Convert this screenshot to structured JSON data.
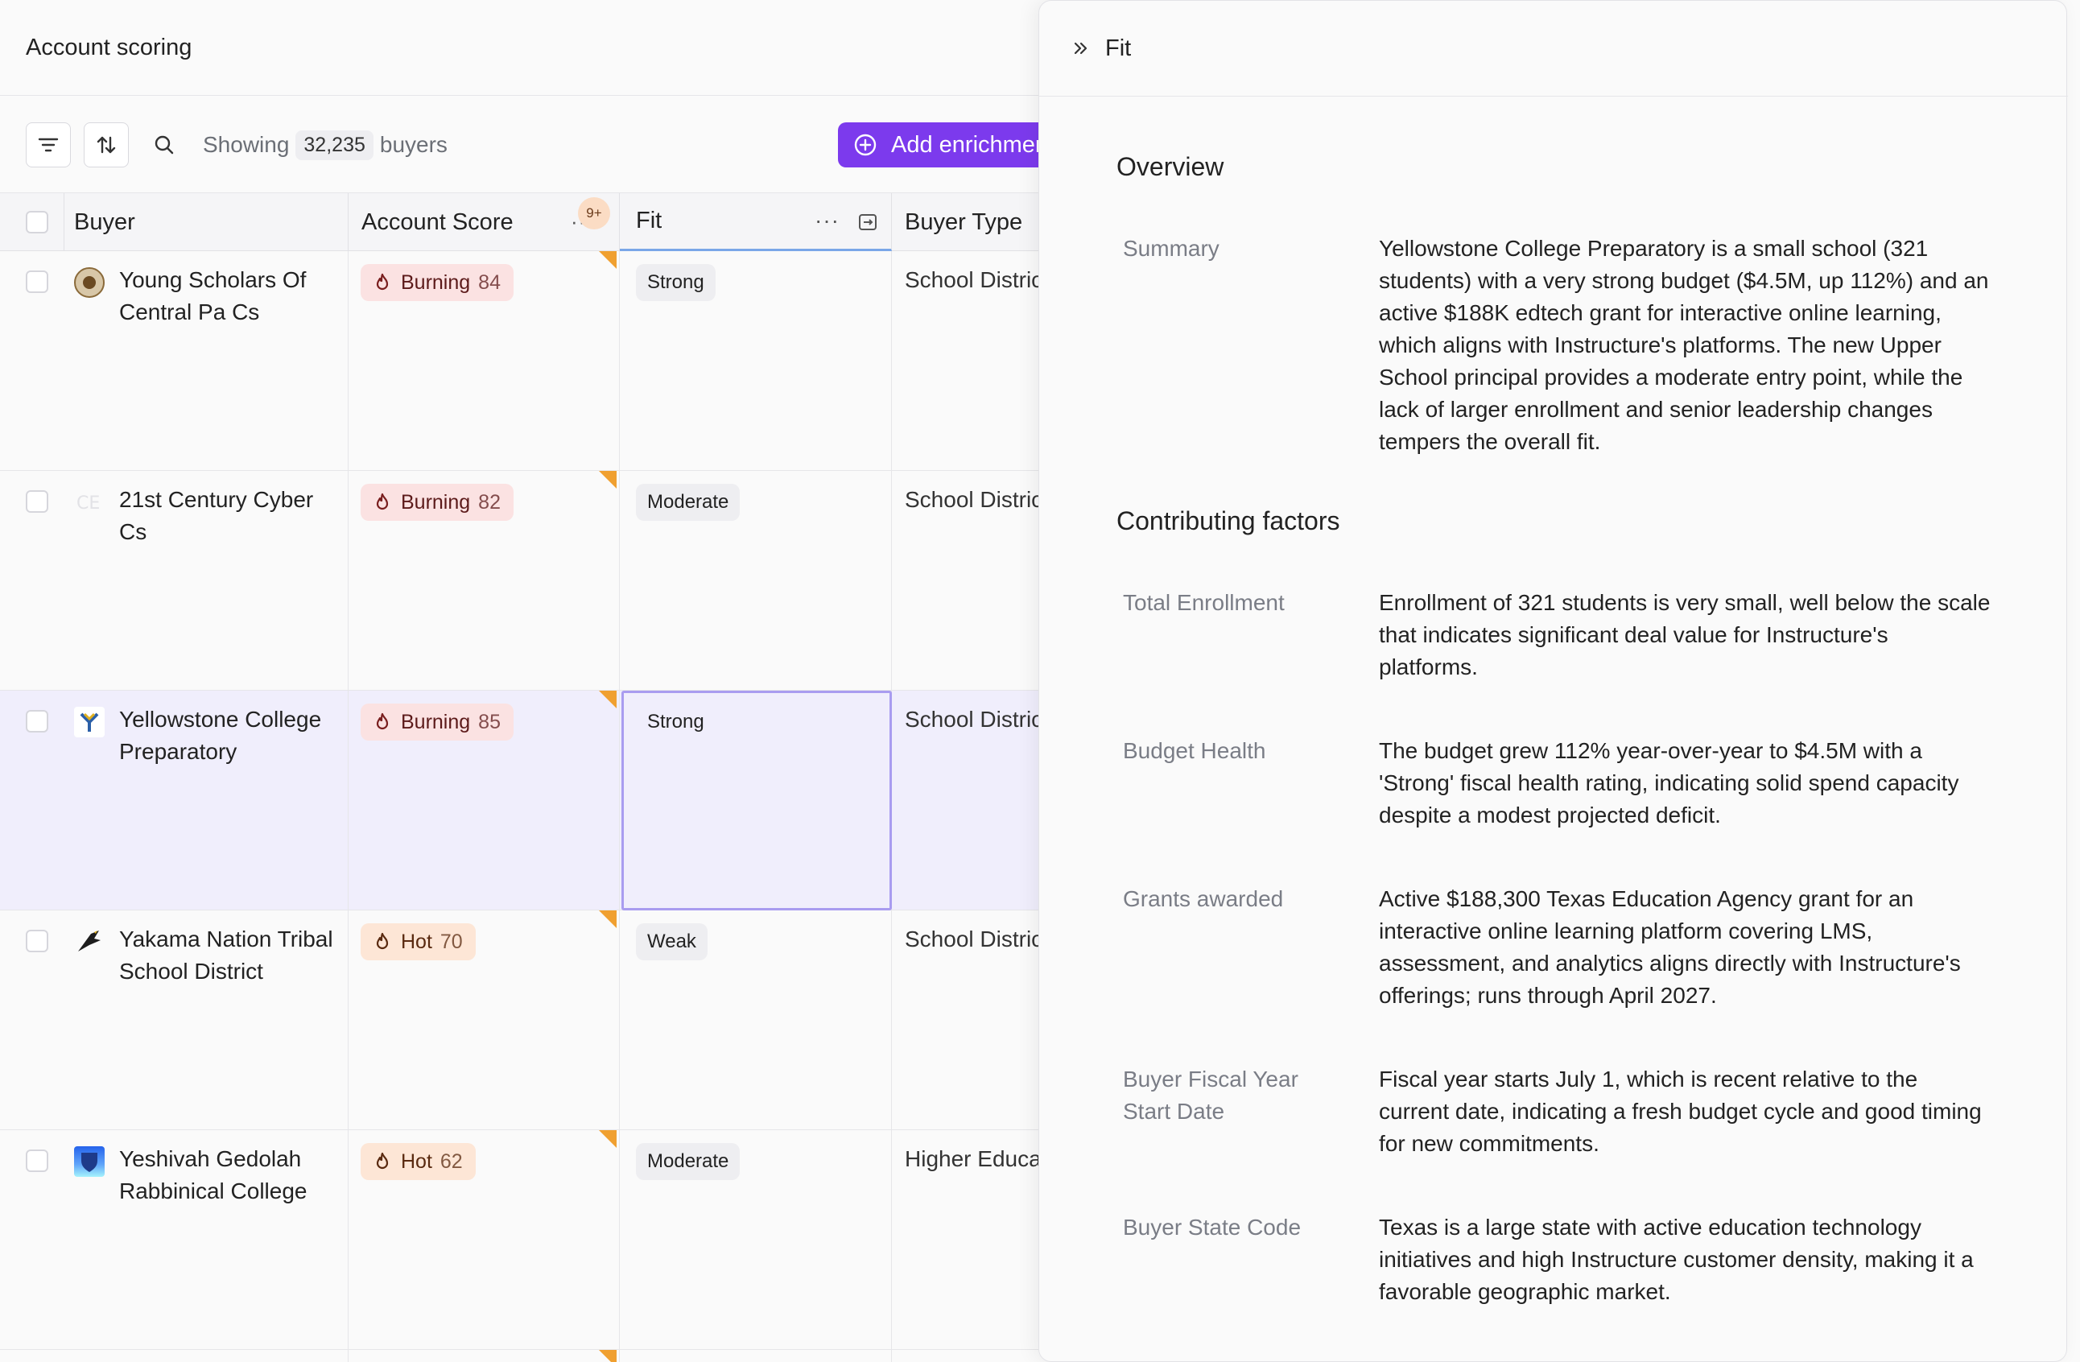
{
  "app": {
    "title": "Account scoring"
  },
  "toolbar": {
    "showing_label": "Showing",
    "count": "32,235",
    "count_suffix": "buyers",
    "enrich_label": "Add enrichment",
    "accent": "#7c3aed"
  },
  "columns": {
    "buyer": "Buyer",
    "score": "Account Score",
    "score_badge": "9+",
    "fit": "Fit",
    "buyer_type": "Buyer Type"
  },
  "rows": [
    {
      "name": "Young Scholars Of Central Pa Cs",
      "score_label": "Burning",
      "score": "84",
      "fit": "Strong",
      "buyer_type": "School District"
    },
    {
      "name": "21st Century Cyber Cs",
      "score_label": "Burning",
      "score": "82",
      "fit": "Moderate",
      "buyer_type": "School District"
    },
    {
      "name": "Yellowstone College Preparatory",
      "score_label": "Burning",
      "score": "85",
      "fit": "Strong",
      "buyer_type": "School District"
    },
    {
      "name": "Yakama Nation Tribal School District",
      "score_label": "Hot",
      "score": "70",
      "fit": "Weak",
      "buyer_type": "School District"
    },
    {
      "name": "Yeshivah Gedolah Rabbinical College",
      "score_label": "Hot",
      "score": "62",
      "fit": "Moderate",
      "buyer_type": "Higher Education"
    }
  ],
  "panel": {
    "title": "Fit",
    "overview_title": "Overview",
    "summary_key": "Summary",
    "summary": "Yellowstone College Preparatory is a small school (321 students) with a very strong budget ($4.5M, up 112%) and an active $188K edtech grant for interactive online learning, which aligns with Instructure's platforms. The new Upper School principal provides a moderate entry point, while the lack of larger enrollment and senior leadership changes tempers the overall fit.",
    "factors_title": "Contributing factors",
    "factors": [
      {
        "key": "Total Enrollment",
        "value": "Enrollment of 321 students is very small, well below the scale that indicates significant deal value for Instructure's platforms."
      },
      {
        "key": "Budget Health",
        "value": "The budget grew 112% year-over-year to $4.5M with a 'Strong' fiscal health rating, indicating solid spend capacity despite a modest projected deficit."
      },
      {
        "key": "Grants awarded",
        "value": "Active $188,300 Texas Education Agency grant for an interactive online learning platform covering LMS, assessment, and analytics aligns directly with Instructure's offerings; runs through April 2027."
      },
      {
        "key": "Buyer Fiscal Year Start Date",
        "value": "Fiscal year starts July 1, which is recent relative to the current date, indicating a fresh budget cycle and good timing for new commitments."
      },
      {
        "key": "Buyer State Code",
        "value": "Texas is a large state with active education technology initiatives and high Instructure customer density, making it a favorable geographic market."
      }
    ]
  }
}
